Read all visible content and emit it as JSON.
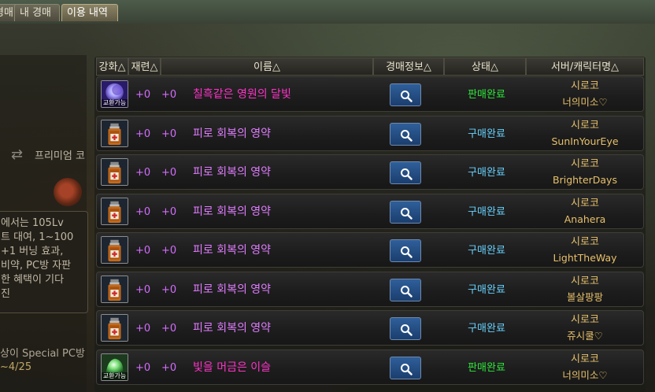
{
  "tabs": [
    {
      "label": "경매"
    },
    {
      "label": "내 경매"
    },
    {
      "label": "이용 내역"
    }
  ],
  "background_text": {
    "premium": "프리미엄 코",
    "benefit_lines": [
      "에서는 105Lv",
      "트 대여, 1~100",
      "+1 버닝 효과,",
      "비약, PC방 자판",
      "한 혜택이 기다",
      "진"
    ],
    "special_pc": "상이 Special PC방",
    "date": "~4/25"
  },
  "colors": {
    "sold": "#2ee83a",
    "bought": "#67d2ff",
    "item_pink": "#ff33c8",
    "item_violet": "#e07cff",
    "char_gold": "#e7c06b"
  },
  "table": {
    "headers": {
      "enhance": "강화△",
      "spell": "재련△",
      "name": "이름△",
      "auction_info": "경매정보△",
      "status": "상태△",
      "server_char": "서버/캐릭터명△"
    },
    "rows": [
      {
        "icon": "moon-orb-icon",
        "badge": "교환가능",
        "enhance": "+0",
        "spell": "+0",
        "name": "칠흑같은 영원의 달빛",
        "name_color": "pink",
        "status": "판매완료",
        "status_type": "sold",
        "server": "시로코",
        "character": "너의미소♡"
      },
      {
        "icon": "potion-bottle-icon",
        "badge": "",
        "enhance": "+0",
        "spell": "+0",
        "name": "피로 회복의 영약",
        "name_color": "violet",
        "status": "구매완료",
        "status_type": "bought",
        "server": "시로코",
        "character": "SunInYourEye"
      },
      {
        "icon": "potion-bottle-icon",
        "badge": "",
        "enhance": "+0",
        "spell": "+0",
        "name": "피로 회복의 영약",
        "name_color": "violet",
        "status": "구매완료",
        "status_type": "bought",
        "server": "시로코",
        "character": "BrighterDays"
      },
      {
        "icon": "potion-bottle-icon",
        "badge": "",
        "enhance": "+0",
        "spell": "+0",
        "name": "피로 회복의 영약",
        "name_color": "violet",
        "status": "구매완료",
        "status_type": "bought",
        "server": "시로코",
        "character": "Anahera"
      },
      {
        "icon": "potion-bottle-icon",
        "badge": "",
        "enhance": "+0",
        "spell": "+0",
        "name": "피로 회복의 영약",
        "name_color": "violet",
        "status": "구매완료",
        "status_type": "bought",
        "server": "시로코",
        "character": "LightTheWay"
      },
      {
        "icon": "potion-bottle-icon",
        "badge": "",
        "enhance": "+0",
        "spell": "+0",
        "name": "피로 회복의 영약",
        "name_color": "violet",
        "status": "구매완료",
        "status_type": "bought",
        "server": "시로코",
        "character": "볼살팡팡"
      },
      {
        "icon": "potion-bottle-icon",
        "badge": "",
        "enhance": "+0",
        "spell": "+0",
        "name": "피로 회복의 영약",
        "name_color": "violet",
        "status": "구매완료",
        "status_type": "bought",
        "server": "시로코",
        "character": "쥬시쿨♡"
      },
      {
        "icon": "green-orb-icon",
        "badge": "교환가능",
        "enhance": "+0",
        "spell": "+0",
        "name": "빛을 머금은 이슬",
        "name_color": "pink",
        "status": "판매완료",
        "status_type": "sold",
        "server": "시로코",
        "character": "너의미소♡"
      }
    ]
  }
}
